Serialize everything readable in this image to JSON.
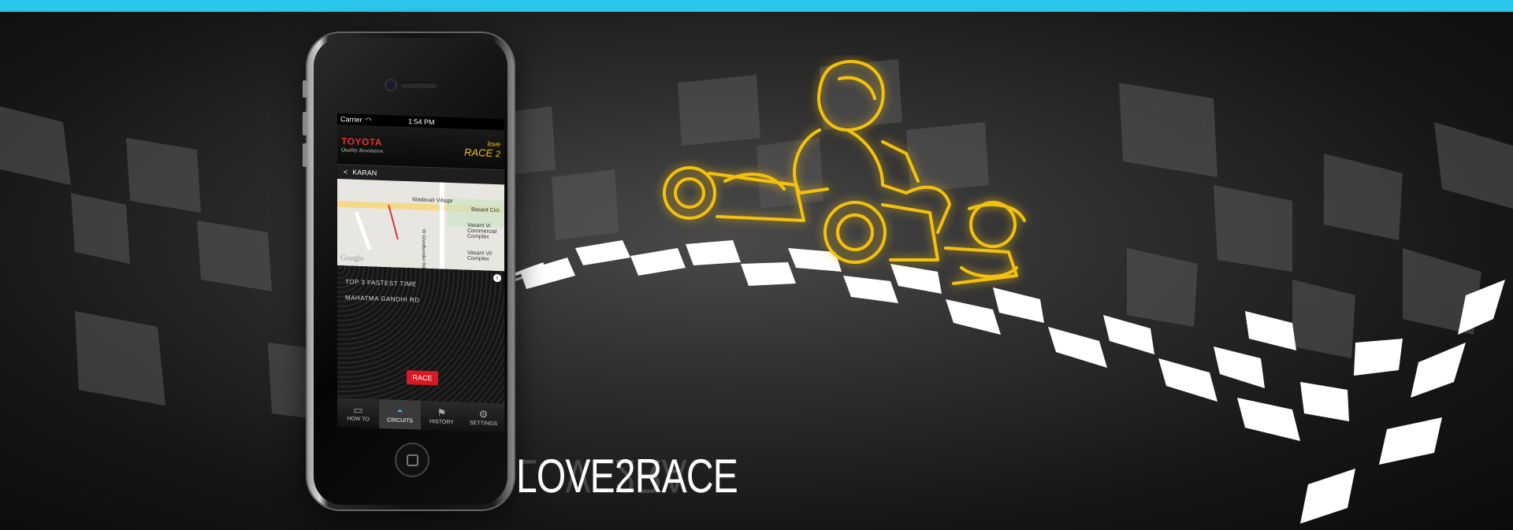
{
  "app": {
    "name": "LOVE2RACE"
  },
  "colors": {
    "top_bar": "#2bc6ea",
    "accent_yellow": "#f3c10e",
    "race_red": "#d71921"
  },
  "phone": {
    "status": {
      "carrier": "Carrier",
      "time": "1:54 PM"
    },
    "header": {
      "brand_name": "TOYOTA",
      "brand_tagline": "Quality Revolution",
      "app_logo_top": "love",
      "app_logo_mid": "RACE",
      "app_logo_num": "2"
    },
    "nav": {
      "back_icon": "chevron-left-icon",
      "title": "KARAN"
    },
    "map": {
      "labels": [
        "Wadavali Village",
        "Basant Circ",
        "W Ghodbunder Rd",
        "Vasant Vi Commercial Complex",
        "Vasant Vil Complex"
      ],
      "attribution": "Google"
    },
    "content": {
      "section_title": "TOP 3 FASTEST TIME",
      "entry": "MAHATMA GANDHI RD",
      "race_button": "RACE"
    },
    "tabs": [
      {
        "label": "HOW TO",
        "icon": "speech-bubble-icon",
        "active": false
      },
      {
        "label": "CIRCUITS",
        "icon": "helmet-icon",
        "active": true
      },
      {
        "label": "HISTORY",
        "icon": "flag-history-icon",
        "active": false
      },
      {
        "label": "SETTINGS",
        "icon": "gear-icon",
        "active": false
      }
    ]
  },
  "hero": {
    "title": "LOVE2RACE",
    "illustration": "neon-go-kart-driver-icon",
    "background": "checkered-flag-icon"
  }
}
